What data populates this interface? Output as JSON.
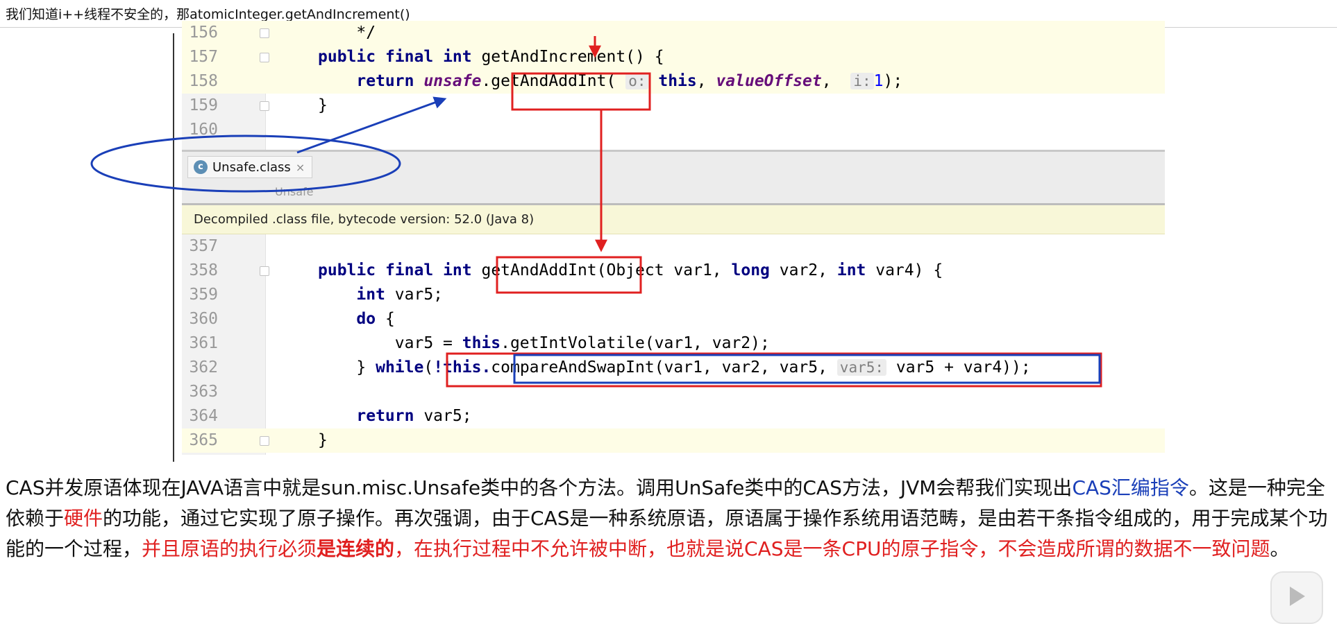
{
  "topbar": {
    "question": "我们知道i++线程不安全的，那atomicInteger.getAndIncrement()"
  },
  "top_code": [
    {
      "num": "156",
      "text": "    */",
      "fold": true
    },
    {
      "num": "157",
      "fold": true
    },
    {
      "num": "158"
    },
    {
      "num": "159",
      "fold": true
    },
    {
      "num": "160"
    }
  ],
  "code_tokens": {
    "public": "public",
    "final": "final",
    "int": "int",
    "return": "return",
    "this": "this",
    "long": "long",
    "do": "do",
    "while": "while",
    "getAndIncrement": " getAndIncrement() {",
    "unsafe": "unsafe",
    "dot": ".",
    "getAndAddInt": "getAndAddInt",
    "paren_open": "(",
    "hint_o": "o:",
    "valueOffset": "valueOffset",
    "comma": ", ",
    "hint_i": "i:",
    "one": "1",
    "end_call": ");",
    "close_brace": "}",
    "getAndAddInt_params": "(Object var1, ",
    "var2_params": " var2, ",
    "var4_params": " var4) {",
    "var5_decl": " var5;",
    "do_brace": " {",
    "getIntVolatile_call": ".getIntVolatile(var1, var2);",
    "not_this": "!this.",
    "compareAndSwapInt": "compareAndSwapInt(var1, var2, var5, ",
    "hint_var5": "var5:",
    "var5_plus_var4": " var5 + var4)",
    "close_paren_semi": ");",
    "return_var5": " var5;"
  },
  "tab": {
    "label": "Unsafe.class",
    "close": "×",
    "icon": "c"
  },
  "breadcrumb": "Unsafe",
  "banner": "Decompiled .class file, bytecode version: 52.0 (Java 8)",
  "bottom_code": [
    {
      "num": "357"
    },
    {
      "num": "358",
      "fold": true
    },
    {
      "num": "359"
    },
    {
      "num": "360"
    },
    {
      "num": "361"
    },
    {
      "num": "362"
    },
    {
      "num": "363"
    },
    {
      "num": "364"
    },
    {
      "num": "365",
      "fold": true
    }
  ],
  "paragraph": {
    "p1": "CAS并发原语体现在JAVA语言中就是sun.misc.Unsafe类中的各个方法。调用UnSafe类中的CAS方法，JVM会帮我们实现出",
    "p2": "CAS汇编指令",
    "p3": "。这是一种完全依赖于",
    "p4": "硬件",
    "p5": "的功能，通过它实现了原子操作。再次强调，由于CAS是一种系统原语，原语属于操作系统用语范畴，是由若干条指令组成的，用于完成某个功能的一个过程，",
    "p6": "并且原语的执行必须",
    "p7": "是连续的",
    "p8": "，在执行过程中不允许被中断，也就是说CAS是一条CPU的原子指令，不会造成所谓的数据不一致问题",
    "p9": "。"
  },
  "colors": {
    "keyword": "#000080",
    "field": "#660e7a",
    "number": "#0000ff",
    "annotation_red": "#e02020",
    "annotation_blue": "#1a3fb8"
  },
  "icons": {
    "play": "play-icon"
  }
}
